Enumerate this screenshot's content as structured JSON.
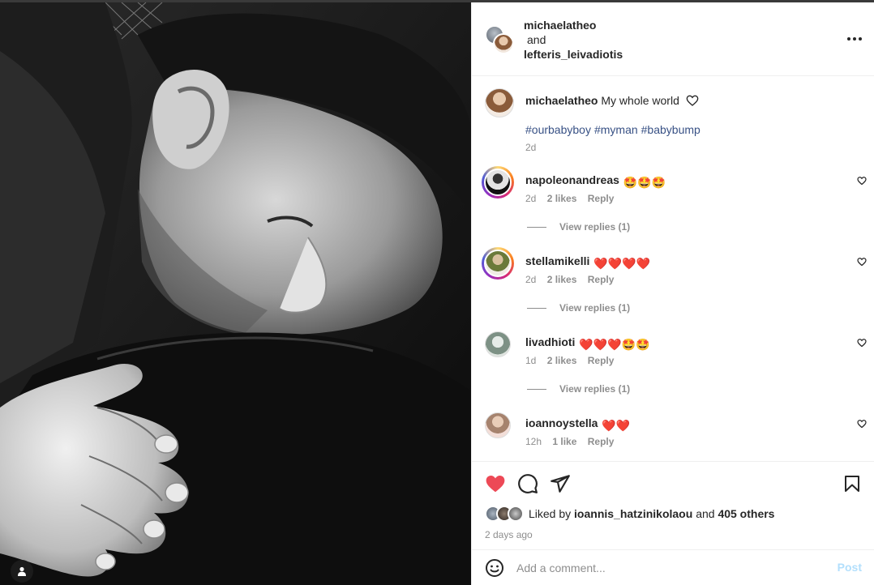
{
  "post_header": {
    "user1": "michaelatheo",
    "and_text": "and",
    "user2": "lefteris_leivadiotis"
  },
  "caption": {
    "username": "michaelatheo",
    "text": "My whole world",
    "hashtags": [
      "#ourbabyboy",
      "#myman",
      "#babybump"
    ],
    "time": "2d"
  },
  "comments": [
    {
      "username": "napoleonandreas",
      "emojis": "🤩🤩🤩",
      "time": "2d",
      "likes": "2 likes",
      "reply": "Reply",
      "view_replies": "View replies (1)"
    },
    {
      "username": "stellamikelli",
      "emojis": "❤️❤️❤️❤️",
      "time": "2d",
      "likes": "2 likes",
      "reply": "Reply",
      "view_replies": "View replies (1)"
    },
    {
      "username": "livadhioti",
      "emojis": "❤️❤️❤️🤩🤩",
      "time": "1d",
      "likes": "2 likes",
      "reply": "Reply",
      "view_replies": "View replies (1)"
    },
    {
      "username": "ioannoystella",
      "emojis": "❤️❤️",
      "time": "12h",
      "likes": "1 like",
      "reply": "Reply"
    }
  ],
  "likes": {
    "prefix": "Liked by",
    "user": "ioannis_hatzinikolaou",
    "and_text": "and",
    "others": "405 others"
  },
  "post_age": "2 days ago",
  "add_comment": {
    "placeholder": "Add a comment...",
    "post_label": "Post"
  },
  "icons": {
    "like": "heart-filled-icon",
    "comment": "comment-icon",
    "share": "paper-plane-icon",
    "save": "bookmark-icon",
    "more": "more-horizontal-icon",
    "emoji": "emoji-smile-icon",
    "tags": "user-tag-icon"
  },
  "colors": {
    "like_red": "#ed4956",
    "hashtag_blue": "#385185",
    "post_disabled": "#b2dffc",
    "secondary_text": "#8e8e8e"
  }
}
